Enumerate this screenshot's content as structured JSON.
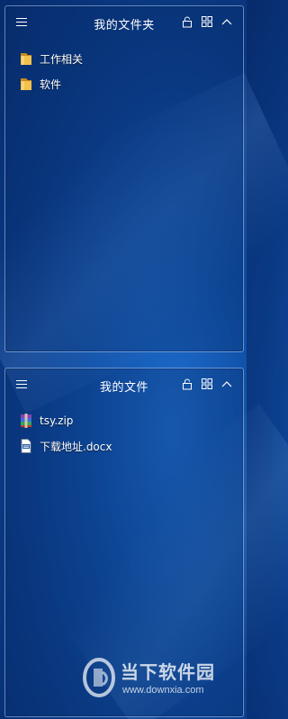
{
  "fences": [
    {
      "title": "我的文件夹",
      "items": [
        {
          "label": "工作相关",
          "icon": "folder-icon"
        },
        {
          "label": "软件",
          "icon": "folder-icon"
        }
      ]
    },
    {
      "title": "我的文件",
      "items": [
        {
          "label": "tsy.zip",
          "icon": "zip-archive-icon"
        },
        {
          "label": "下载地址.docx",
          "icon": "document-icon"
        }
      ]
    }
  ],
  "watermark": {
    "brand": "当下软件园",
    "url": "www.downxia.com"
  },
  "colors": {
    "desktop_bg": "#0a3a85",
    "fence_border": "#b4d2ff",
    "text": "#ffffff",
    "folder": "#f2c14e"
  }
}
